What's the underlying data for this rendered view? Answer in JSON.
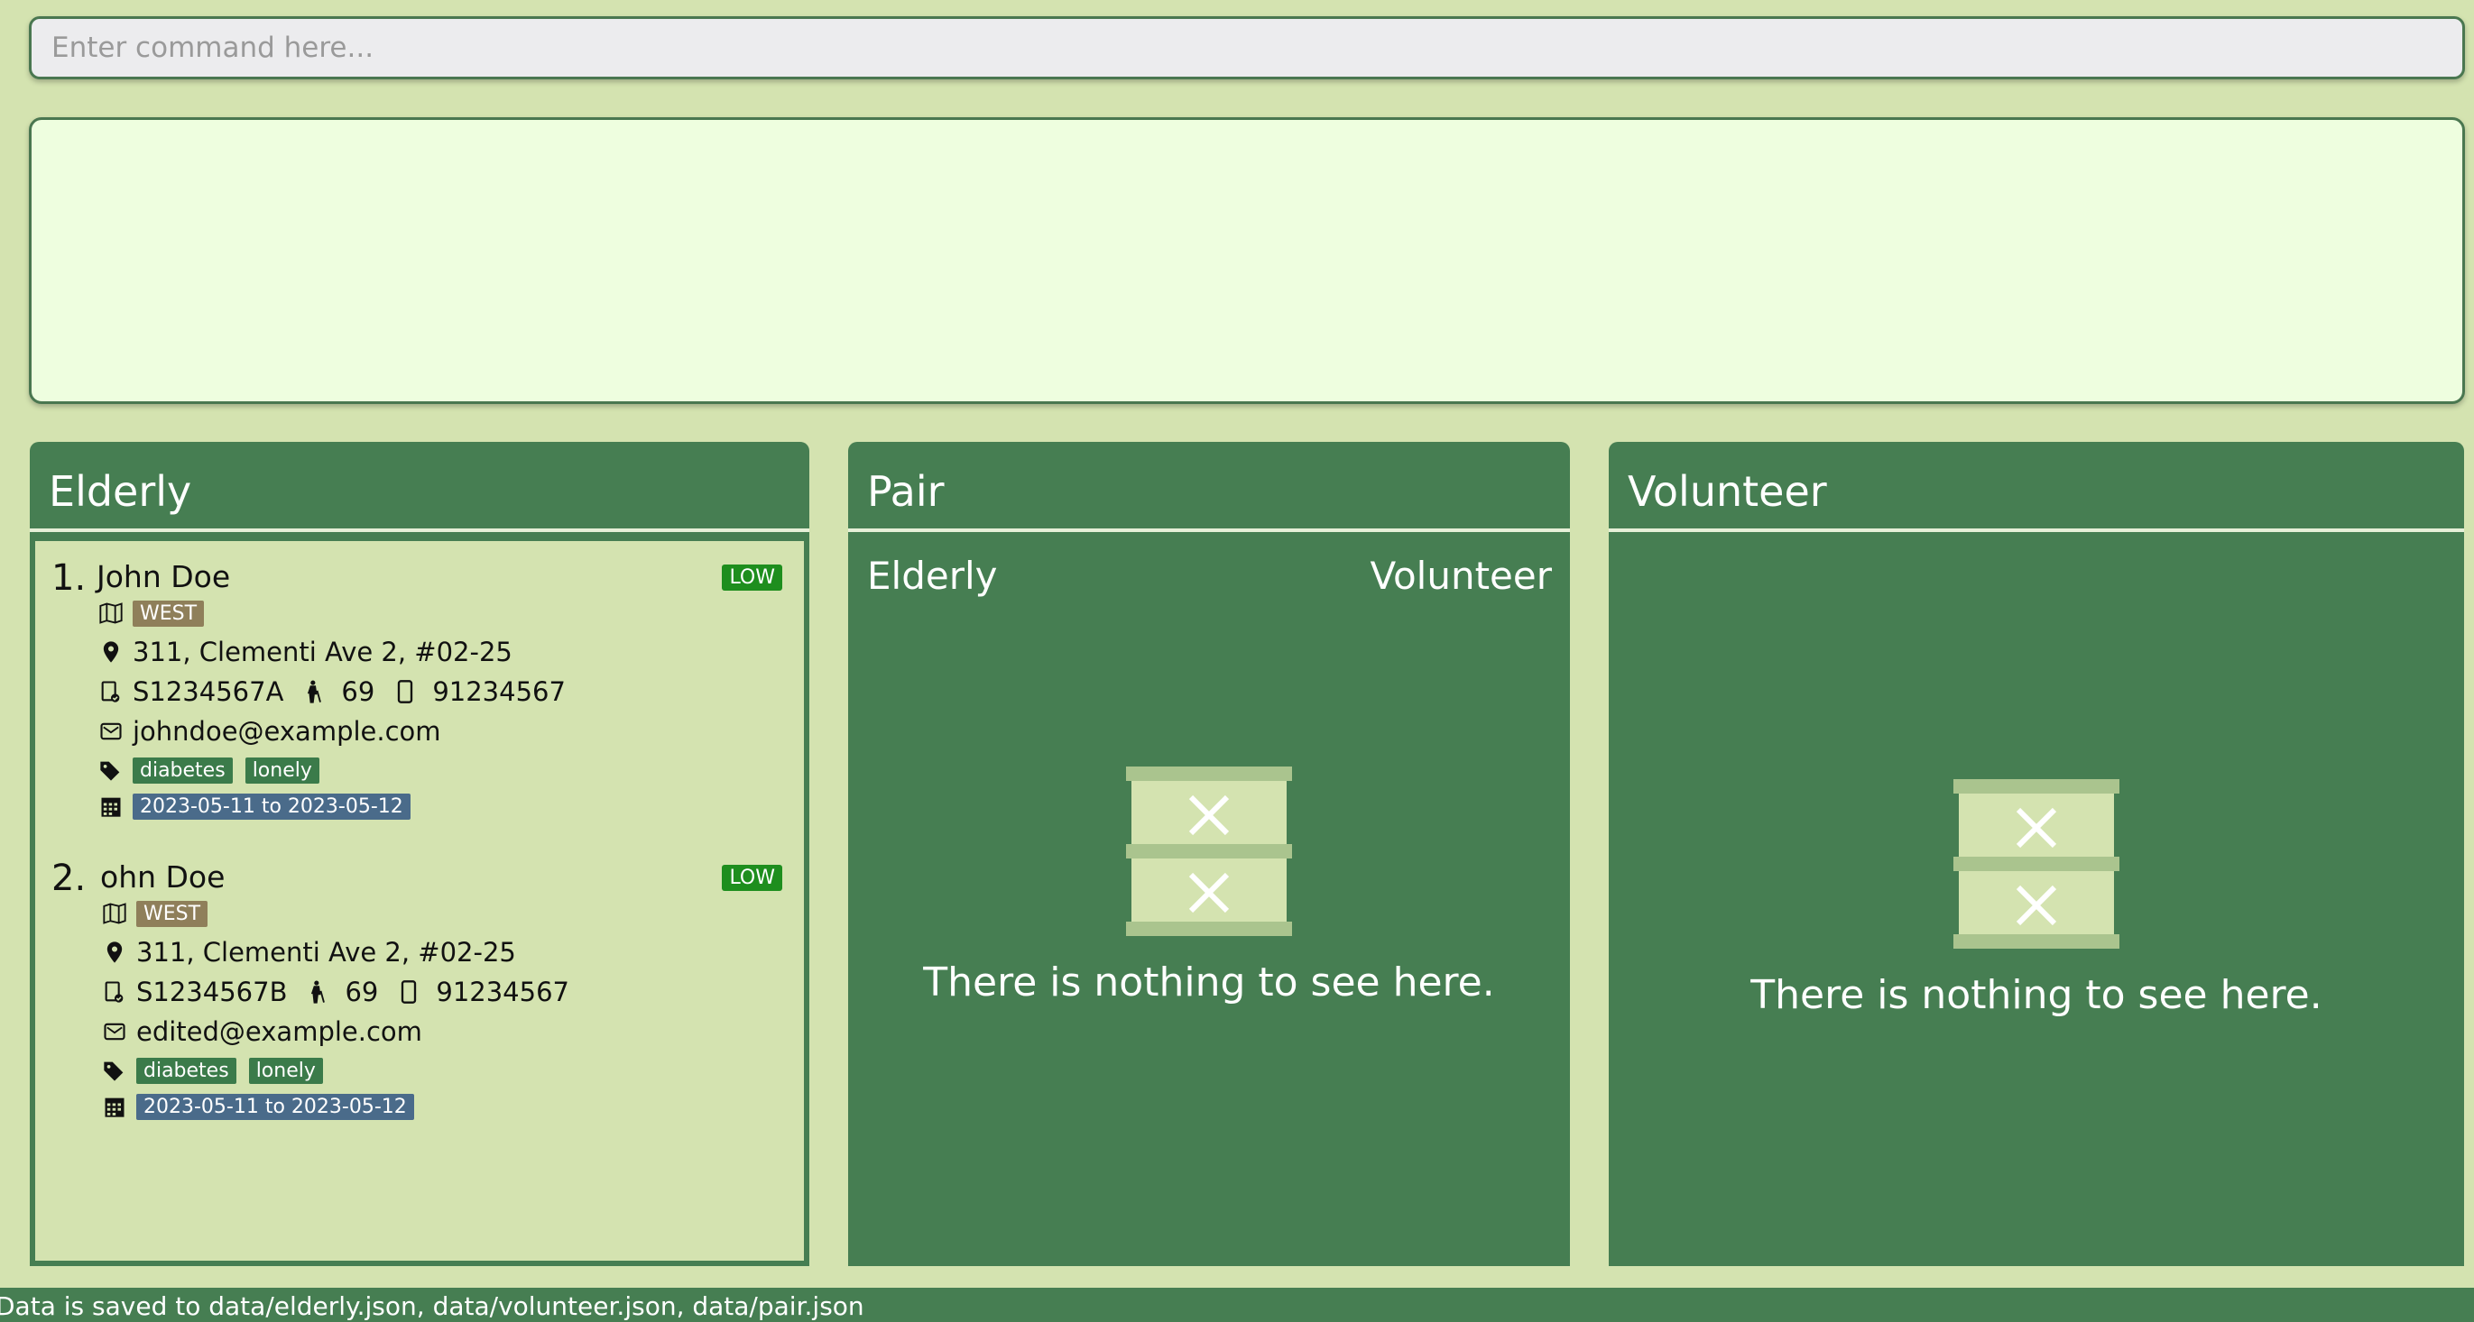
{
  "command": {
    "placeholder": "Enter command here...",
    "value": ""
  },
  "result": {
    "text": ""
  },
  "elderly_panel": {
    "title": "Elderly",
    "items": [
      {
        "index": "1.",
        "name": "John Doe",
        "risk": "LOW",
        "region": "WEST",
        "address": "311, Clementi Ave 2, #02-25",
        "nric": "S1234567A",
        "age": "69",
        "phone": "91234567",
        "email": "johndoe@example.com",
        "tags": [
          "diabetes",
          "lonely"
        ],
        "availability": "2023-05-11 to 2023-05-12"
      },
      {
        "index": "2.",
        "name": "ohn Doe",
        "risk": "LOW",
        "region": "WEST",
        "address": "311, Clementi Ave 2, #02-25",
        "nric": "S1234567B",
        "age": "69",
        "phone": "91234567",
        "email": "edited@example.com",
        "tags": [
          "diabetes",
          "lonely"
        ],
        "availability": "2023-05-11 to 2023-05-12"
      }
    ]
  },
  "pair_panel": {
    "title": "Pair",
    "col_elderly": "Elderly",
    "col_volunteer": "Volunteer",
    "empty_text": "There is nothing to see here."
  },
  "volunteer_panel": {
    "title": "Volunteer",
    "empty_text": "There is nothing to see here."
  },
  "status_bar": {
    "text": "Data is saved to data/elderly.json, data/volunteer.json, data/pair.json"
  },
  "colors": {
    "background": "#d4e3b0",
    "panel": "#467e52",
    "risk_low": "#1e8e1e",
    "region_tag": "#8f7f5a",
    "date_tag": "#4a6b8a"
  },
  "icons": [
    "map-icon",
    "location-pin-icon",
    "id-card-icon",
    "person-age-icon",
    "phone-icon",
    "mail-icon",
    "tag-icon",
    "calendar-icon",
    "empty-box-icon"
  ]
}
